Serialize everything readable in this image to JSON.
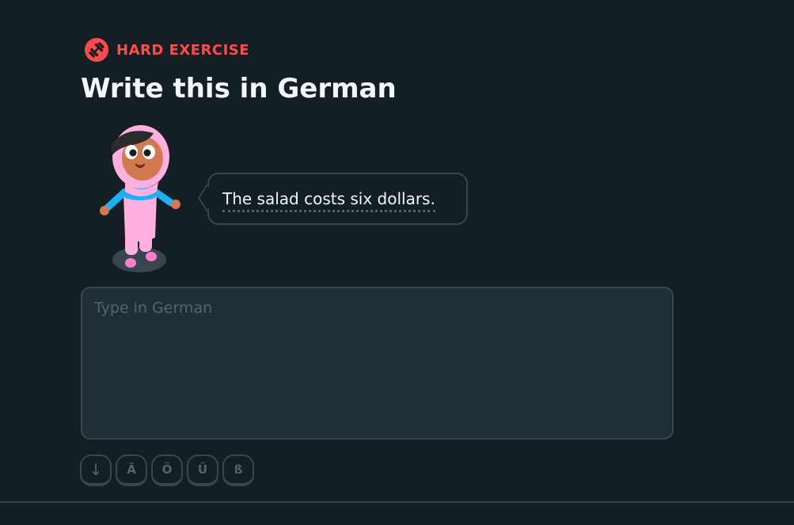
{
  "badge": {
    "label": "HARD EXERCISE",
    "icon": "dumbbell-icon",
    "color": "#ff4b4b"
  },
  "title": "Write this in German",
  "prompt": {
    "sentence": "The salad costs six dollars."
  },
  "answer": {
    "placeholder": "Type in German",
    "value": ""
  },
  "special_keys": [
    "↓",
    "Ä",
    "Ö",
    "Ü",
    "ß"
  ],
  "colors": {
    "background": "#131f24",
    "border": "#37464f",
    "input_background": "#202f36",
    "muted": "#52656d",
    "text": "#f1f7fb"
  }
}
